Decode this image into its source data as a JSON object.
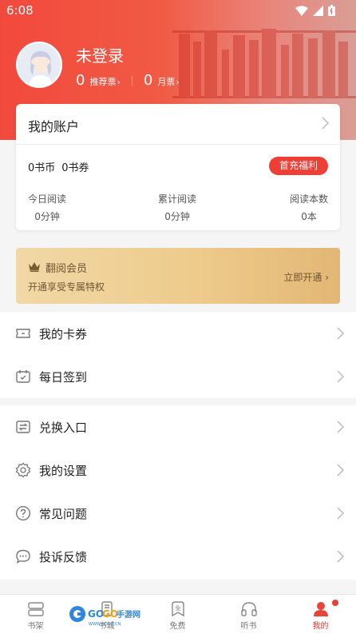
{
  "status_bar": {
    "time": "6:08"
  },
  "profile": {
    "username": "未登录",
    "recommend_count": "0",
    "recommend_label": "推荐票",
    "monthly_count": "0",
    "monthly_label": "月票"
  },
  "account": {
    "title": "我的账户",
    "coins": "0书币",
    "vouchers": "0书券",
    "first_charge_button": "首充福利",
    "stats": [
      {
        "label": "今日阅读",
        "value": "0分钟"
      },
      {
        "label": "累计阅读",
        "value": "0分钟"
      },
      {
        "label": "阅读本数",
        "value": "0本"
      }
    ]
  },
  "vip": {
    "title": "翻阅会员",
    "subtitle": "开通享受专属特权",
    "cta": "立即开通"
  },
  "menu_group_1": [
    {
      "label": "我的卡券",
      "icon": "ticket-icon"
    },
    {
      "label": "每日签到",
      "icon": "calendar-check-icon"
    }
  ],
  "menu_group_2": [
    {
      "label": "兑换入口",
      "icon": "exchange-icon"
    },
    {
      "label": "我的设置",
      "icon": "gear-icon"
    },
    {
      "label": "常见问题",
      "icon": "question-icon"
    },
    {
      "label": "投诉反馈",
      "icon": "chat-bubble-icon"
    }
  ],
  "tabs": [
    {
      "label": "书架",
      "icon": "bookshelf-icon"
    },
    {
      "label": "书城",
      "icon": "bookstore-icon"
    },
    {
      "label": "免费",
      "icon": "free-icon"
    },
    {
      "label": "听书",
      "icon": "headphones-icon"
    },
    {
      "label": "我的",
      "icon": "profile-icon",
      "active": true
    }
  ],
  "watermark": {
    "text": "GOGO手游网",
    "url_text": "WWW.GOGO.CN"
  },
  "colors": {
    "brand_red": "#ef3e35",
    "vip_text": "#6f5533",
    "active_tab": "#e53a30"
  }
}
